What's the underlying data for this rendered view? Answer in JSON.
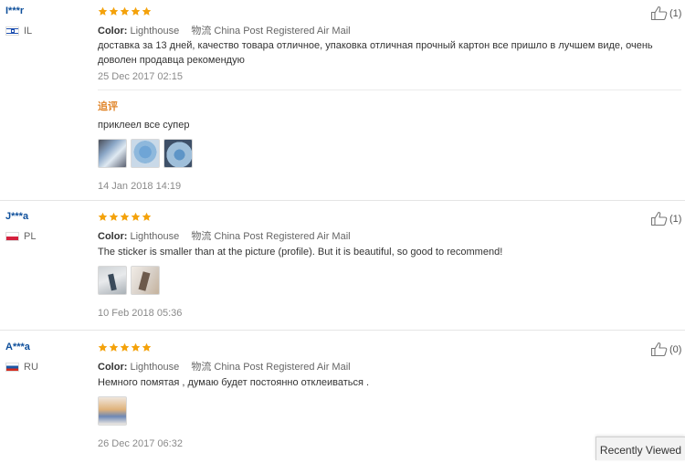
{
  "reviews": [
    {
      "user": "I***r",
      "country": "IL",
      "color_label": "Color:",
      "color": "Lighthouse",
      "ship_label": "物流",
      "shipping": "China Post Registered Air Mail",
      "text": "доставка за 13 дней, качество товара отличное, упаковка отличная прочный картон все пришло в лучшем виде, очень доволен продавца рекомендую",
      "date": "25 Dec 2017 02:15",
      "helpful": "(1)",
      "stars": 5,
      "additional": {
        "label": "追评",
        "text": "приклеел все супер",
        "date": "14 Jan 2018 14:19",
        "photo_count": 3
      }
    },
    {
      "user": "J***a",
      "country": "PL",
      "color_label": "Color:",
      "color": "Lighthouse",
      "ship_label": "物流",
      "shipping": "China Post Registered Air Mail",
      "text": "The sticker is smaller than at the picture (profile). But it is beautiful, so good to recommend!",
      "date": "10 Feb 2018 05:36",
      "helpful": "(1)",
      "stars": 5,
      "photo_count": 2
    },
    {
      "user": "A***a",
      "country": "RU",
      "color_label": "Color:",
      "color": "Lighthouse",
      "ship_label": "物流",
      "shipping": "China Post Registered Air Mail",
      "text": "Немного помятая , думаю будет постоянно отклеиваться .",
      "date": "26 Dec 2017 06:32",
      "helpful": "(0)",
      "stars": 5,
      "photo_count": 1
    }
  ],
  "recently_viewed": "Recently Viewed",
  "colors": {
    "star": "#f4a20b",
    "user_link": "#0e4f9b",
    "additional_label": "#e0852a"
  }
}
